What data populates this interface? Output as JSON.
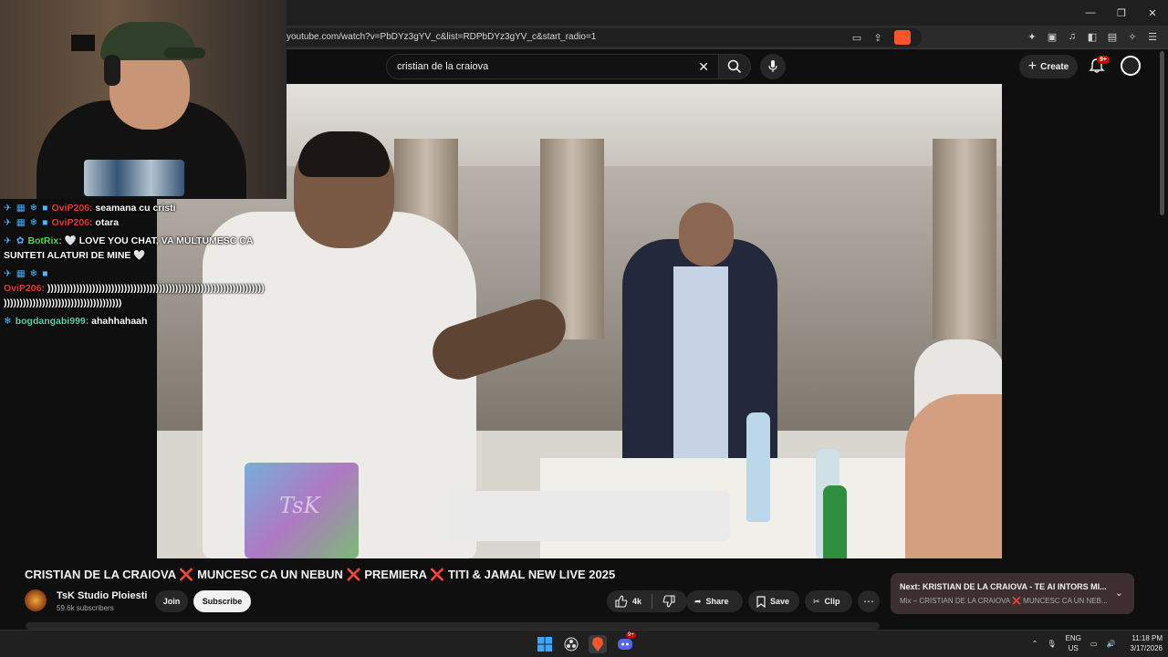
{
  "browser": {
    "url": "youtube.com/watch?v=PbDYz3gYV_c&list=RDPbDYz3gYV_c&start_radio=1",
    "window_controls": [
      "minimize",
      "maximize",
      "close"
    ]
  },
  "masthead": {
    "search_query": "cristian de la craiova",
    "create_label": "Create",
    "notification_badge": "9+"
  },
  "video": {
    "watermark": "TsK"
  },
  "chat": [
    {
      "badges": "✈ ▦ ❄ ■",
      "user": "OviP206",
      "color": "#e33b3b",
      "message": "seamana cu cristi"
    },
    {
      "badges": "✈ ▦ ❄ ■",
      "user": "OviP206",
      "color": "#e33b3b",
      "message": "otara"
    },
    {
      "badges": "✈ ✿",
      "user": "BotRix",
      "color": "#5ad45a",
      "message": "🤍 LOVE YOU CHAT, VA MULTUMESC CA",
      "message2": "SUNTETI ALATURI DE MINE 🤍"
    },
    {
      "badges": "✈ ▦ ❄ ■",
      "user": "OviP206",
      "color": "#e33b3b",
      "message": "))))))))))))))))))))))))))))))))))))))))))))))))))))))))))))))))))))",
      "message2": ")))))))))))))))))))))))))))))))))))))"
    },
    {
      "badges": "❄",
      "user": "bogdangabi999",
      "color": "#5fcfae",
      "message": "ahahhahaah"
    }
  ],
  "watch": {
    "title_parts": [
      "CRISTIAN DE LA CRAIOVA",
      "MUNCESC CA UN NEBUN",
      "PREMIERA",
      "TITI & JAMAL NEW LIVE 2025"
    ],
    "separator": "❌",
    "channel_name": "TsK Studio Ploiesti",
    "subscribers": "59.6k subscribers",
    "join_label": "Join",
    "subscribe_label": "Subscribe",
    "likes": "4k",
    "share_label": "Share",
    "save_label": "Save",
    "clip_label": "Clip",
    "next_title": "Next: KRISTIAN DE LA CRAIOVA - TE AI INTORS MI...",
    "next_sub": "Mix – CRISTIAN DE LA CRAIOVA ❌ MUNCESC CA UN NEB..."
  },
  "taskbar": {
    "lang_top": "ENG",
    "lang_bottom": "US",
    "time": "11:18 PM",
    "date": "3/17/2026",
    "discord_badge": "9+"
  }
}
